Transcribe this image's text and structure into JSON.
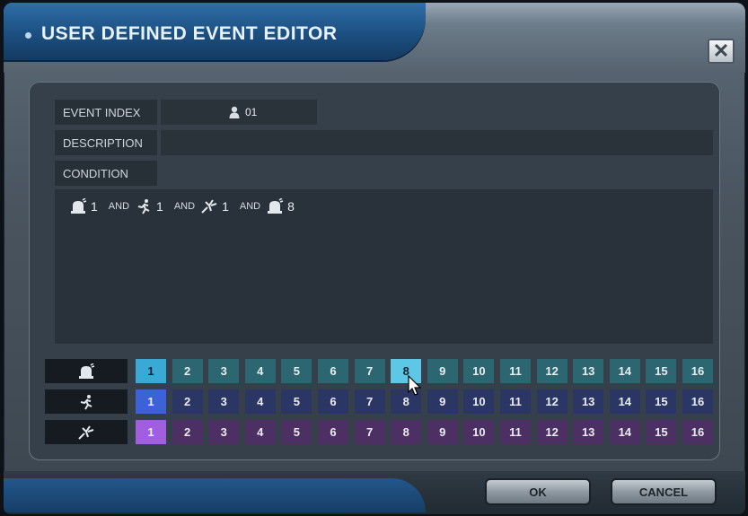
{
  "window": {
    "title": "USER DEFINED EVENT EDITOR",
    "close_label": "✕"
  },
  "fields": {
    "event_index_label": "EVENT INDEX",
    "event_index_value": "01",
    "description_label": "DESCRIPTION",
    "description_value": "",
    "condition_label": "CONDITION"
  },
  "condition": {
    "items": [
      {
        "icon": "alarm-icon",
        "value": "1"
      },
      {
        "icon": "motion-icon",
        "value": "1"
      },
      {
        "icon": "video-loss-icon",
        "value": "1"
      },
      {
        "icon": "alarm-icon",
        "value": "8"
      }
    ],
    "joiner": "AND"
  },
  "grid": {
    "rows": [
      {
        "name": "alarm",
        "icon": "alarm-icon",
        "selected": [
          1,
          8
        ]
      },
      {
        "name": "motion",
        "icon": "motion-icon",
        "selected": [
          1
        ]
      },
      {
        "name": "video-loss",
        "icon": "video-loss-icon",
        "selected": [
          1
        ]
      }
    ],
    "channels": [
      "1",
      "2",
      "3",
      "4",
      "5",
      "6",
      "7",
      "8",
      "9",
      "10",
      "11",
      "12",
      "13",
      "14",
      "15",
      "16"
    ]
  },
  "buttons": {
    "ok": "OK",
    "cancel": "CANCEL"
  },
  "colors": {
    "title_bar": "#1c4f80",
    "alarm_row": "#2c6670",
    "motion_row": "#2b3665",
    "video_loss_row": "#4c2f63",
    "alarm_selected": "#3ba9d6",
    "motion_selected": "#3d61d6",
    "video_loss_selected": "#a25ee0"
  }
}
